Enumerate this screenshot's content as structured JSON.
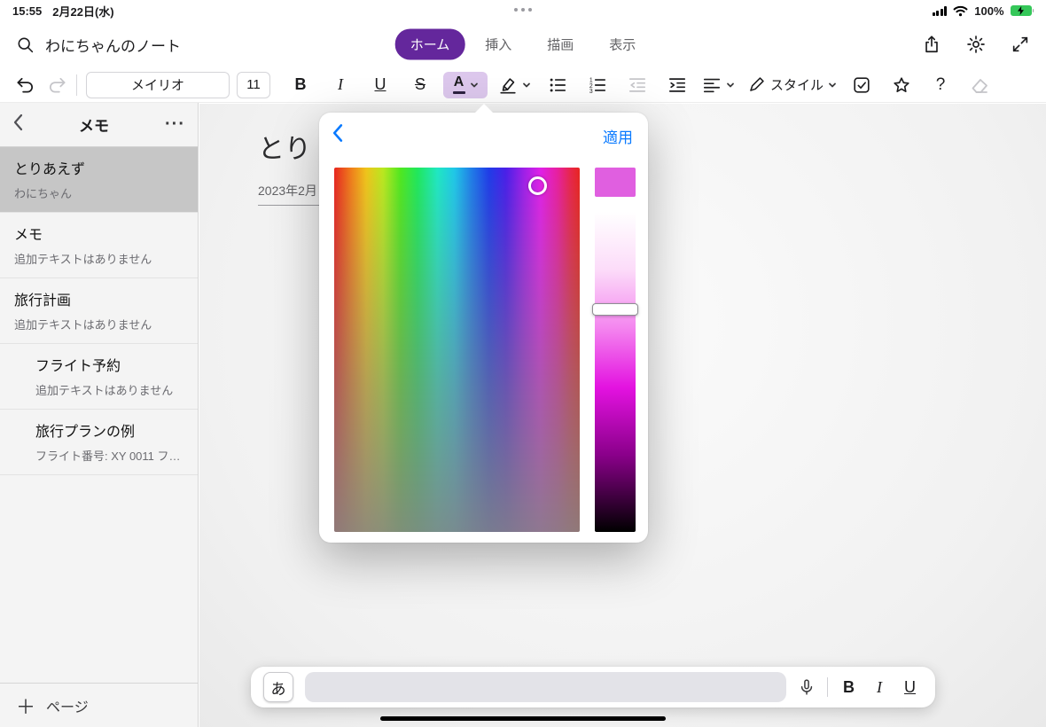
{
  "status_bar": {
    "time": "15:55",
    "date": "2月22日(水)",
    "battery_percent": "100%"
  },
  "header": {
    "notebook_title": "わにちゃんのノート",
    "tabs": [
      {
        "label": "ホーム",
        "active": true
      },
      {
        "label": "挿入",
        "active": false
      },
      {
        "label": "描画",
        "active": false
      },
      {
        "label": "表示",
        "active": false
      }
    ]
  },
  "format_toolbar": {
    "font_name": "メイリオ",
    "font_size": "11",
    "bold": "B",
    "italic": "I",
    "underline": "U",
    "strikethrough": "S",
    "font_color": "A",
    "styles_label": "スタイル",
    "help_label": "?"
  },
  "sidebar": {
    "title": "メモ",
    "items": [
      {
        "title": "とりあえず",
        "subtitle": "わにちゃん",
        "selected": true,
        "indented": false
      },
      {
        "title": "メモ",
        "subtitle": "追加テキストはありません",
        "selected": false,
        "indented": false
      },
      {
        "title": "旅行計画",
        "subtitle": "追加テキストはありません",
        "selected": false,
        "indented": false
      },
      {
        "title": "フライト予約",
        "subtitle": "追加テキストはありません",
        "selected": false,
        "indented": true
      },
      {
        "title": "旅行プランの例",
        "subtitle": "フライト番号: XY 0011 フ…",
        "selected": false,
        "indented": true
      }
    ],
    "add_page_label": "ページ"
  },
  "page": {
    "title": "とり",
    "date": "2023年2月"
  },
  "color_picker": {
    "apply_label": "適用",
    "selected_color": "#E05FE0"
  },
  "input_bar": {
    "language_key": "あ",
    "bold": "B",
    "italic": "I",
    "underline": "U"
  },
  "colors": {
    "accent_purple": "#64279C",
    "link_blue": "#0A7AFF",
    "battery_green": "#35C759"
  }
}
